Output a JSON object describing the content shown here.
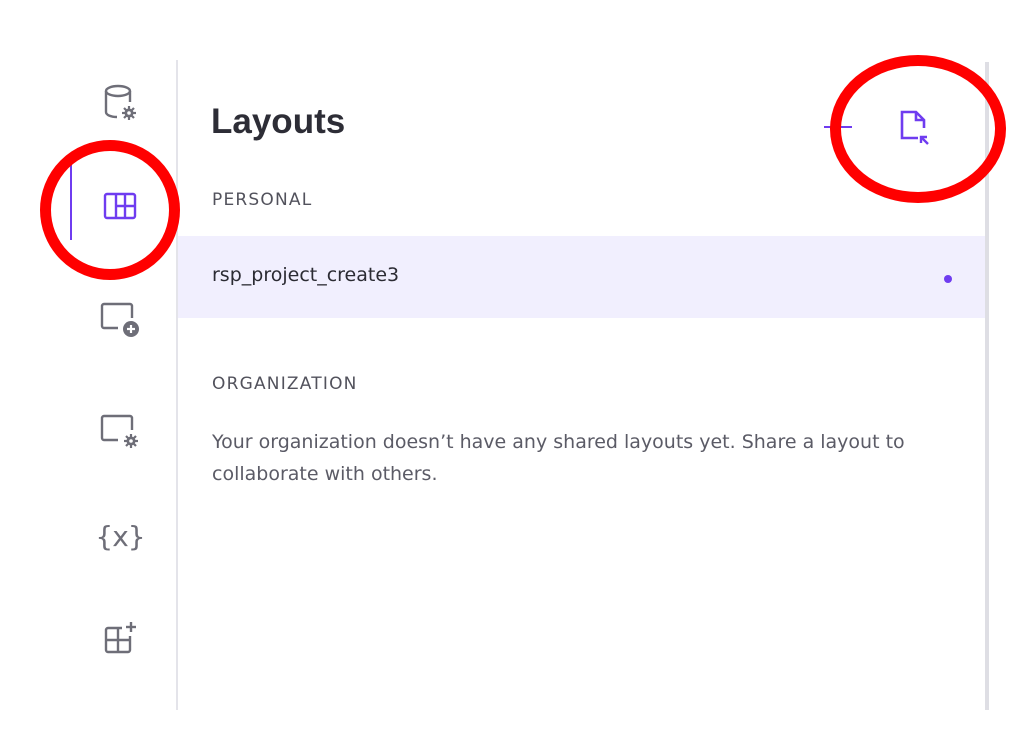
{
  "panel": {
    "title": "Layouts",
    "sections": {
      "personal": "PERSONAL",
      "organization": "ORGANIZATION"
    },
    "personal_layouts": [
      {
        "name": "rsp_project_create3"
      }
    ],
    "organization_empty_message": "Your organization doesn’t have any shared layouts yet. Share a layout to collaborate with others."
  },
  "sidebar": {
    "items": [
      {
        "icon": "data-source-settings-icon"
      },
      {
        "icon": "layouts-grid-icon",
        "active": true
      },
      {
        "icon": "add-panel-icon"
      },
      {
        "icon": "panel-settings-icon"
      },
      {
        "icon": "variables-icon",
        "glyph": "{x}"
      },
      {
        "icon": "extensions-add-icon"
      }
    ]
  },
  "colors": {
    "accent": "#6f3cf0",
    "annotation": "#ff0000",
    "selected_row": "#f1effe"
  }
}
